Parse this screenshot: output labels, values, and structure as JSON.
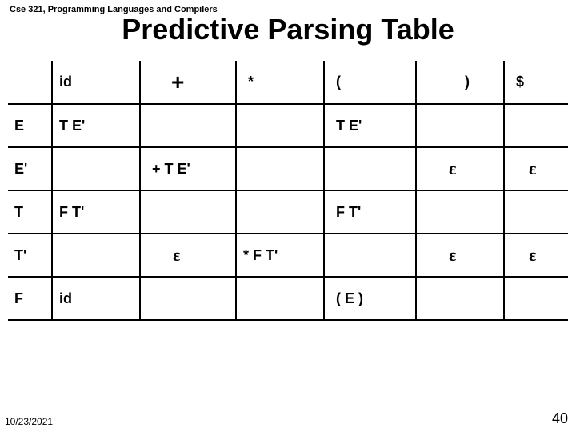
{
  "header": "Cse 321, Programming Languages and Compilers",
  "title": "Predictive Parsing Table",
  "cols": {
    "c0": "",
    "c1": "id",
    "c2": "+",
    "c3": "*",
    "c4": "(",
    "c5": ")",
    "c6": "$"
  },
  "rows": {
    "E": {
      "label": "E",
      "id": "T E'",
      "plus": "",
      "star": "",
      "lp": "T E'",
      "rp": "",
      "dol": ""
    },
    "Eprime": {
      "label": "E'",
      "id": "",
      "plus": "+ T E'",
      "star": "",
      "lp": "",
      "rp": "ε",
      "dol": "ε"
    },
    "T": {
      "label": "T",
      "id": "F T'",
      "plus": "",
      "star": "",
      "lp": "F T'",
      "rp": "",
      "dol": ""
    },
    "Tprime": {
      "label": "T'",
      "id": "",
      "plus": "ε",
      "star": "* F  T'",
      "lp": "",
      "rp": "ε",
      "dol": "ε"
    },
    "F": {
      "label": "F",
      "id": "id",
      "plus": "",
      "star": "",
      "lp": "( E )",
      "rp": "",
      "dol": ""
    }
  },
  "footer": {
    "date": "10/23/2021",
    "page": "40"
  }
}
